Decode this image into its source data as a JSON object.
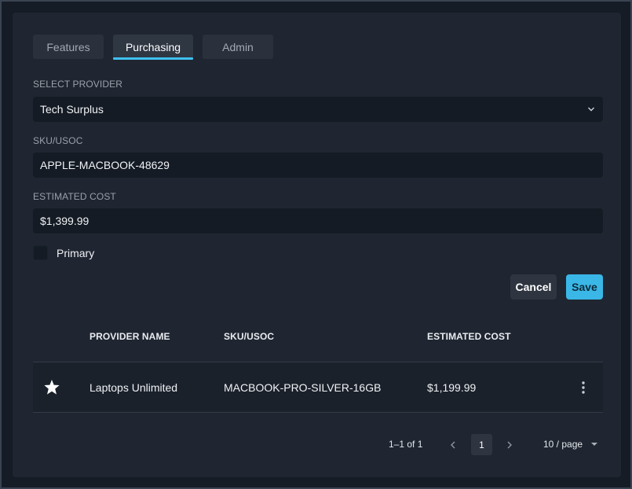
{
  "tabs": [
    {
      "label": "Features",
      "active": false
    },
    {
      "label": "Purchasing",
      "active": true
    },
    {
      "label": "Admin",
      "active": false
    }
  ],
  "form": {
    "provider_label": "SELECT PROVIDER",
    "provider_value": "Tech Surplus",
    "sku_label": "SKU/USOC",
    "sku_value": "APPLE-MACBOOK-48629",
    "cost_label": "ESTIMATED COST",
    "cost_value": "$1,399.99",
    "primary_label": "Primary",
    "primary_checked": false
  },
  "actions": {
    "cancel_label": "Cancel",
    "save_label": "Save"
  },
  "table": {
    "columns": [
      "PROVIDER NAME",
      "SKU/USOC",
      "ESTIMATED COST"
    ],
    "rows": [
      {
        "primary": true,
        "provider": "Laptops Unlimited",
        "sku": "MACBOOK-PRO-SILVER-16GB",
        "cost": "$1,199.99"
      }
    ]
  },
  "pagination": {
    "range": "1–1 of 1",
    "current_page": "1",
    "per_page": "10 / page"
  },
  "colors": {
    "accent": "#3ec1ef",
    "save_button": "#3ab7e6",
    "panel": "#1f2631",
    "input": "#141b24"
  },
  "icons": {
    "select": "chevron-down-icon",
    "primary_marker": "star-icon",
    "row_menu": "more-vertical-icon",
    "prev": "chevron-left-icon",
    "next": "chevron-right-icon",
    "per_page": "caret-down-icon"
  }
}
